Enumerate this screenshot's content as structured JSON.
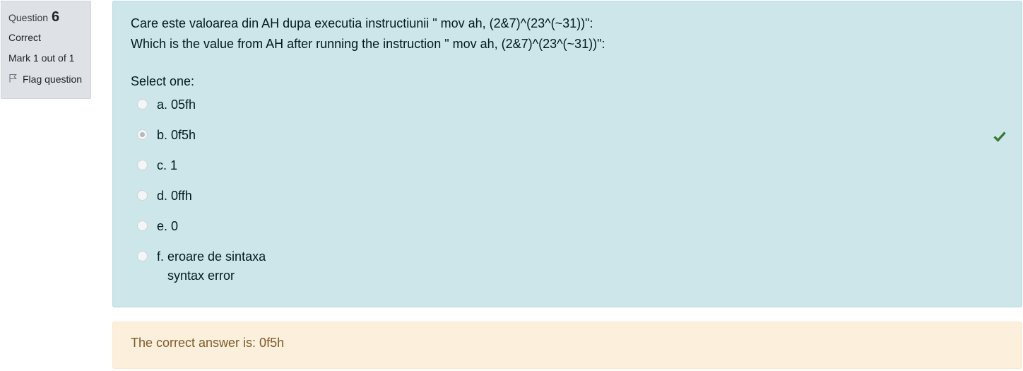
{
  "info": {
    "question_label": "Question",
    "question_number": "6",
    "state": "Correct",
    "grade": "Mark 1 out of 1",
    "flag_label": "Flag question"
  },
  "question": {
    "text_ro": "Care este valoarea din AH dupa executia instructiunii \" mov ah, (2&7)^(23^(~31))\":",
    "text_en": "Which is the value from AH after running the instruction \" mov ah, (2&7)^(23^(~31))\":",
    "prompt": "Select one:",
    "options": [
      {
        "label": "a. 05fh",
        "selected": false
      },
      {
        "label": "b. 0f5h",
        "selected": true,
        "correct": true
      },
      {
        "label": "c. 1",
        "selected": false
      },
      {
        "label": "d. 0ffh",
        "selected": false
      },
      {
        "label": "e. 0",
        "selected": false
      },
      {
        "label": "f. eroare de sintaxa",
        "sublabel": "syntax error",
        "selected": false
      }
    ]
  },
  "feedback": {
    "right_answer": "The correct answer is: 0f5h"
  },
  "colors": {
    "formulation_bg": "#cce6ea",
    "outcome_bg": "#fcefdc",
    "info_bg": "#dee2e6",
    "correct_tick": "#357a32"
  },
  "icons": {
    "flag": "flag-icon",
    "correct": "check-icon"
  }
}
